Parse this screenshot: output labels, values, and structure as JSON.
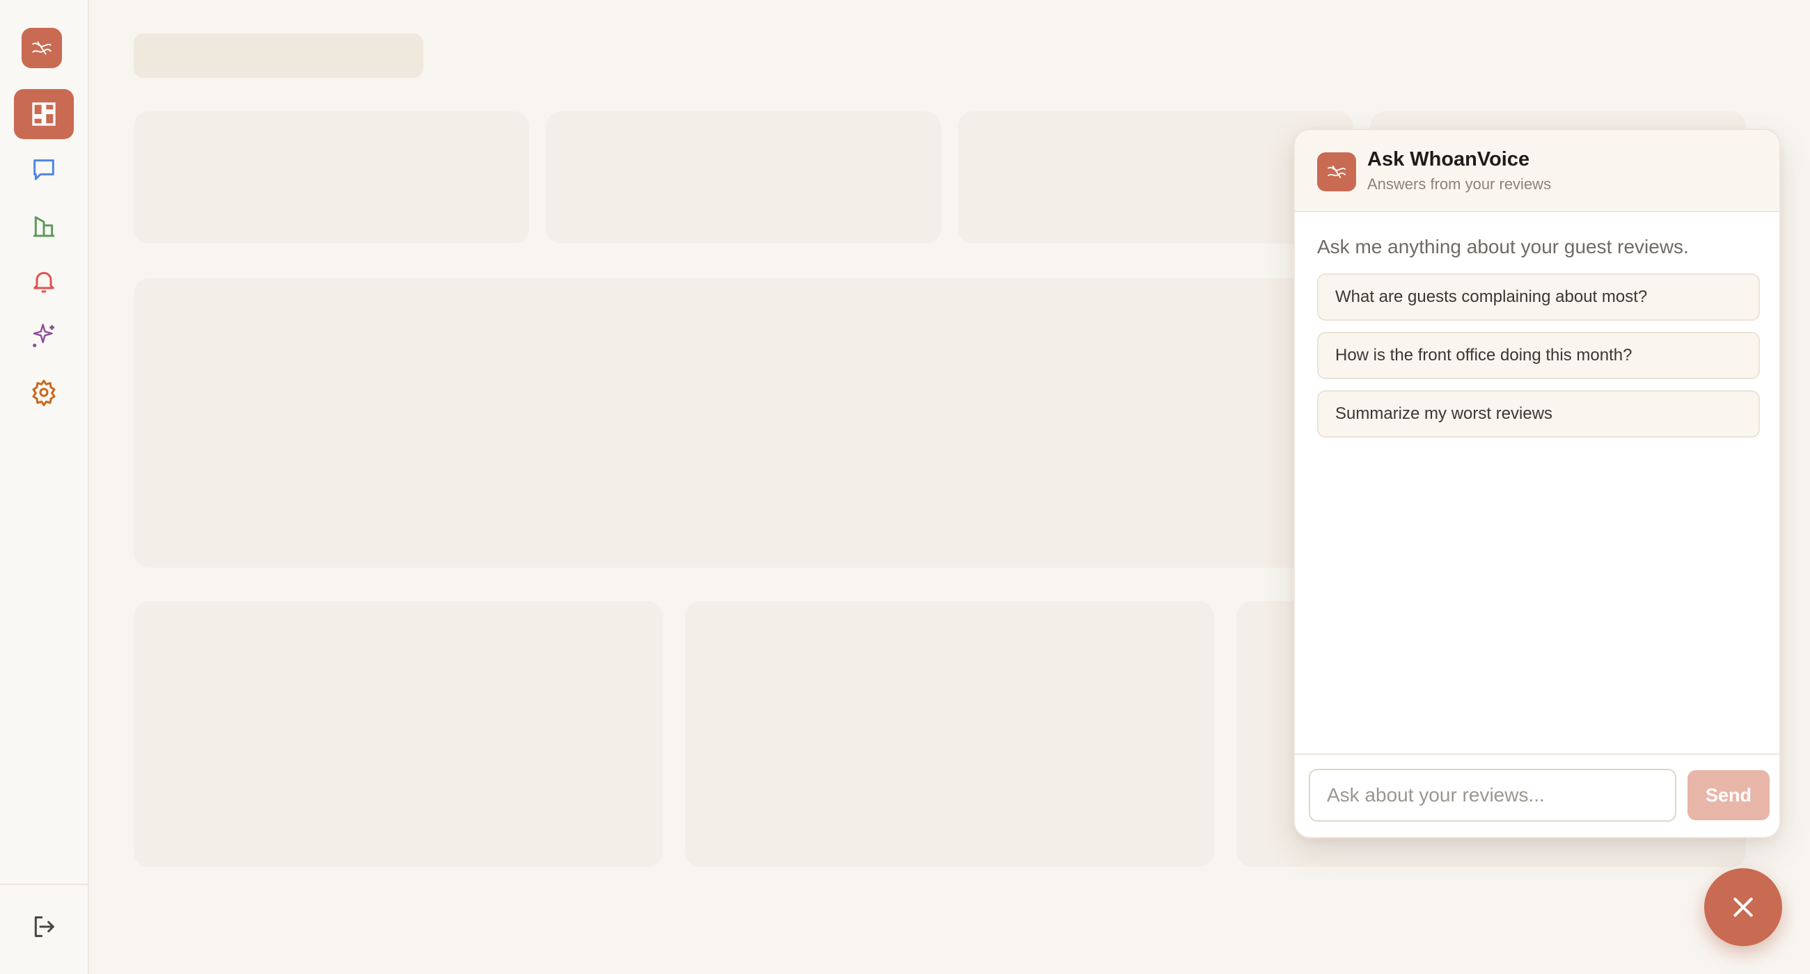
{
  "app": {
    "brand_color": "#c96a52"
  },
  "sidebar": {
    "logo_icon": "scissors-swoosh-icon",
    "items": [
      {
        "name": "dashboard",
        "icon": "dashboard-grid-icon",
        "active": true,
        "color": "#ffffff"
      },
      {
        "name": "reviews",
        "icon": "chat-bubble-icon",
        "active": false,
        "color": "#4f86e6"
      },
      {
        "name": "analytics",
        "icon": "building-chart-icon",
        "active": false,
        "color": "#5f9a5f"
      },
      {
        "name": "alerts",
        "icon": "bell-icon",
        "active": false,
        "color": "#e0524f"
      },
      {
        "name": "ai-insights",
        "icon": "sparkles-icon",
        "active": false,
        "color": "#8a4f96"
      },
      {
        "name": "settings",
        "icon": "gear-icon",
        "active": false,
        "color": "#c9671c"
      }
    ],
    "logout_icon": "logout-icon"
  },
  "chat": {
    "title": "Ask WhoanVoice",
    "subtitle": "Answers from your reviews",
    "intro": "Ask me anything about your guest reviews.",
    "suggestions": [
      "What are guests complaining about most?",
      "How is the front office doing this month?",
      "Summarize my worst reviews"
    ],
    "input_value": "",
    "input_placeholder": "Ask about your reviews...",
    "send_label": "Send"
  },
  "fab": {
    "icon": "close-icon"
  }
}
